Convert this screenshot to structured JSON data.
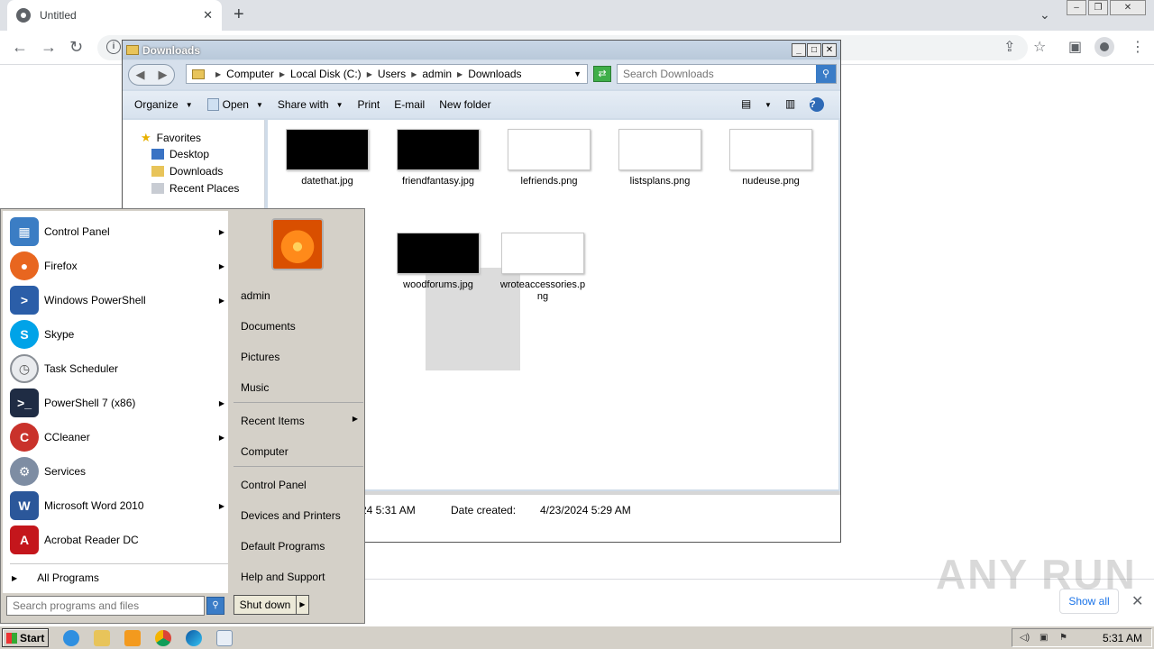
{
  "browser": {
    "tab_title": "Untitled",
    "tab_close": "✕",
    "new_tab": "+",
    "download_bar": {
      "show_all": "Show all",
      "close": "✕"
    },
    "watermark": "ANY RUN"
  },
  "explorer": {
    "title": "Downloads",
    "breadcrumb": [
      "Computer",
      "Local Disk (C:)",
      "Users",
      "admin",
      "Downloads"
    ],
    "search_placeholder": "Search Downloads",
    "commands": {
      "organize": "Organize",
      "open": "Open",
      "share_with": "Share with",
      "print": "Print",
      "email": "E-mail",
      "new_folder": "New folder"
    },
    "nav": {
      "favorites": "Favorites",
      "desktop": "Desktop",
      "downloads": "Downloads",
      "recent_places": "Recent Places"
    },
    "files": [
      {
        "name": "datethat.jpg",
        "thumb": "black"
      },
      {
        "name": "friendfantasy.jpg",
        "thumb": "black"
      },
      {
        "name": "lefriends.png",
        "thumb": "white"
      },
      {
        "name": "listsplans.png",
        "thumb": "white"
      },
      {
        "name": "nudeuse.png",
        "thumb": "white"
      },
      {
        "name": "woodforums.jpg",
        "thumb": "black"
      },
      {
        "name": "wroteaccessories.png",
        "thumb": "white"
      }
    ],
    "details": {
      "date_modified_partial": "24 5:31 AM",
      "date_created_label": "Date created:",
      "date_created_value": "4/23/2024 5:29 AM"
    }
  },
  "start_menu": {
    "programs": [
      {
        "label": "Control Panel",
        "submenu": true,
        "color": "#3b7dc4"
      },
      {
        "label": "Firefox",
        "submenu": true,
        "color": "#e8661f"
      },
      {
        "label": "Windows PowerShell",
        "submenu": true,
        "color": "#2b5ea8"
      },
      {
        "label": "Skype",
        "submenu": false,
        "color": "#00a3e8"
      },
      {
        "label": "Task Scheduler",
        "submenu": false,
        "color": "#8a8f96"
      },
      {
        "label": "PowerShell 7 (x86)",
        "submenu": true,
        "color": "#1f2c44"
      },
      {
        "label": "CCleaner",
        "submenu": true,
        "color": "#c9322b"
      },
      {
        "label": "Services",
        "submenu": false,
        "color": "#7e8da3"
      },
      {
        "label": "Microsoft Word 2010",
        "submenu": true,
        "color": "#2b579a"
      },
      {
        "label": "Acrobat Reader DC",
        "submenu": false,
        "color": "#c4161c"
      }
    ],
    "all_programs": "All Programs",
    "search_placeholder": "Search programs and files",
    "right": {
      "user": "admin",
      "documents": "Documents",
      "pictures": "Pictures",
      "music": "Music",
      "recent_items": "Recent Items",
      "computer": "Computer",
      "control_panel": "Control Panel",
      "devices_printers": "Devices and Printers",
      "default_programs": "Default Programs",
      "help_support": "Help and Support"
    },
    "shutdown": "Shut down"
  },
  "taskbar": {
    "start": "Start",
    "clock": "5:31 AM"
  }
}
